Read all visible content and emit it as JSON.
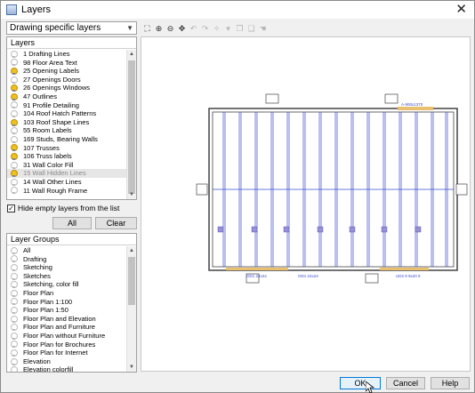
{
  "window": {
    "title": "Layers"
  },
  "combo": {
    "value": "Drawing specific layers"
  },
  "layers": {
    "header": "Layers",
    "items": [
      {
        "label": "1 Drafting Lines",
        "on": false
      },
      {
        "label": "98 Floor Area Text",
        "on": false
      },
      {
        "label": "25 Opening Labels",
        "on": true
      },
      {
        "label": "27 Openings Doors",
        "on": false
      },
      {
        "label": "26 Openings Windows",
        "on": true
      },
      {
        "label": "47 Outlines",
        "on": true
      },
      {
        "label": "91 Profile Detailing",
        "on": false
      },
      {
        "label": "104 Roof Hatch Patterns",
        "on": false
      },
      {
        "label": "103 Roof Shape Lines",
        "on": true
      },
      {
        "label": "55 Room Labels",
        "on": false
      },
      {
        "label": "169 Studs, Bearing Walls",
        "on": false
      },
      {
        "label": "107 Trusses",
        "on": true
      },
      {
        "label": "106 Truss labels",
        "on": true
      },
      {
        "label": "31 Wall Color Fill",
        "on": false
      },
      {
        "label": "15 Wall Hidden Lines",
        "on": true,
        "selected": true
      },
      {
        "label": "14 Wall Other Lines",
        "on": false
      },
      {
        "label": "11 Wall Rough Frame",
        "on": false
      }
    ]
  },
  "hide_empty": {
    "label": "Hide empty layers from the list",
    "checked": true
  },
  "buttons": {
    "all": "All",
    "clear": "Clear",
    "ok": "OK",
    "cancel": "Cancel",
    "help": "Help"
  },
  "groups": {
    "header": "Layer Groups",
    "items": [
      "All",
      "Drafting",
      "Sketching",
      "Sketches",
      "Sketching, color fill",
      "Floor Plan",
      "Floor Plan 1:100",
      "Floor Plan 1:50",
      "Floor Plan and Elevation",
      "Floor Plan and Furniture",
      "Floor Plan without Furniture",
      "Floor Plan for Brochures",
      "Floor Plan for Internet",
      "Elevation",
      "Elevation colorfill"
    ]
  },
  "toolbar": {
    "icons": [
      {
        "name": "zoom-extents-icon",
        "glyph": "⛶",
        "enabled": true
      },
      {
        "name": "zoom-in-icon",
        "glyph": "⊕",
        "enabled": true
      },
      {
        "name": "zoom-out-icon",
        "glyph": "⊖",
        "enabled": true
      },
      {
        "name": "pan-icon",
        "glyph": "✥",
        "enabled": true
      },
      {
        "name": "undo-view-icon",
        "glyph": "↶",
        "enabled": false
      },
      {
        "name": "redo-view-icon",
        "glyph": "↷",
        "enabled": false
      },
      {
        "name": "select-icon",
        "glyph": "✧",
        "enabled": false
      },
      {
        "name": "dropdown-icon",
        "glyph": "▾",
        "enabled": false
      },
      {
        "name": "copy-icon",
        "glyph": "❐",
        "enabled": false
      },
      {
        "name": "paste-icon",
        "glyph": "❏",
        "enabled": false
      },
      {
        "name": "hand-icon",
        "glyph": "☚",
        "enabled": false
      }
    ]
  },
  "drawing": {
    "labels": {
      "top_right_dim": "A-900x1370",
      "bottom_left_dim": "OD1 24x24",
      "bottom_mid_dim": "OD1 24x24",
      "bottom_right_dim": "UD2 9 9x20 9",
      "tag": "Gift"
    },
    "colors": {
      "truss": "#3a4bd0",
      "wall": "#444444",
      "opening": "#e8c070",
      "marker": "#9a8fd0"
    }
  }
}
